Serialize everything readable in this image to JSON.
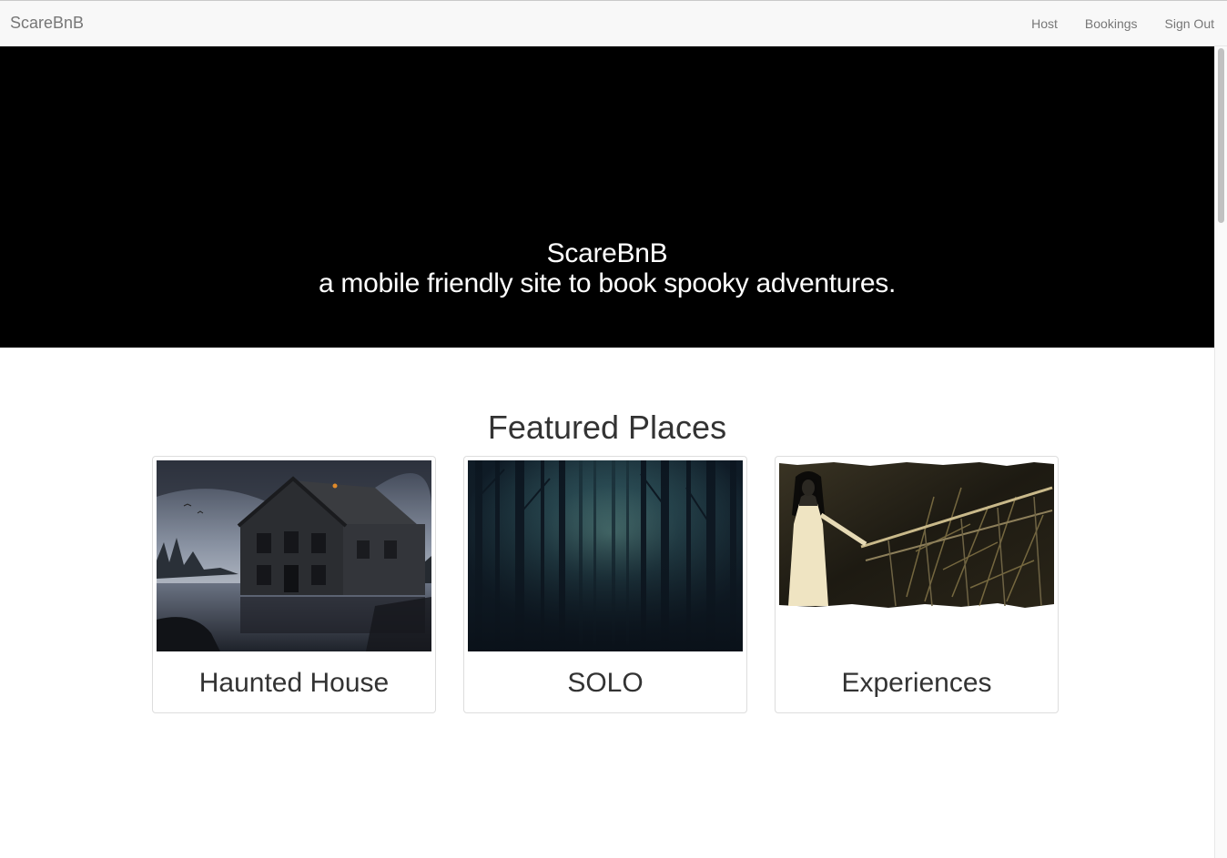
{
  "navbar": {
    "brand": "ScareBnB",
    "links": [
      {
        "label": "Host"
      },
      {
        "label": "Bookings"
      },
      {
        "label": "Sign Out"
      }
    ]
  },
  "hero": {
    "title": "ScareBnB",
    "subtitle": "a mobile friendly site to book spooky adventures."
  },
  "featured": {
    "heading": "Featured Places",
    "cards": [
      {
        "caption": "Haunted House",
        "image": "haunted-house-image"
      },
      {
        "caption": "SOLO",
        "image": "dark-forest-image"
      },
      {
        "caption": "Experiences",
        "image": "ghost-girl-bridge-image"
      }
    ]
  },
  "colors": {
    "navbar_bg": "#f8f8f8",
    "nav_text": "#777777",
    "hero_bg": "#000000",
    "hero_text": "#ffffff",
    "heading_text": "#333333",
    "card_border": "#dddddd"
  }
}
